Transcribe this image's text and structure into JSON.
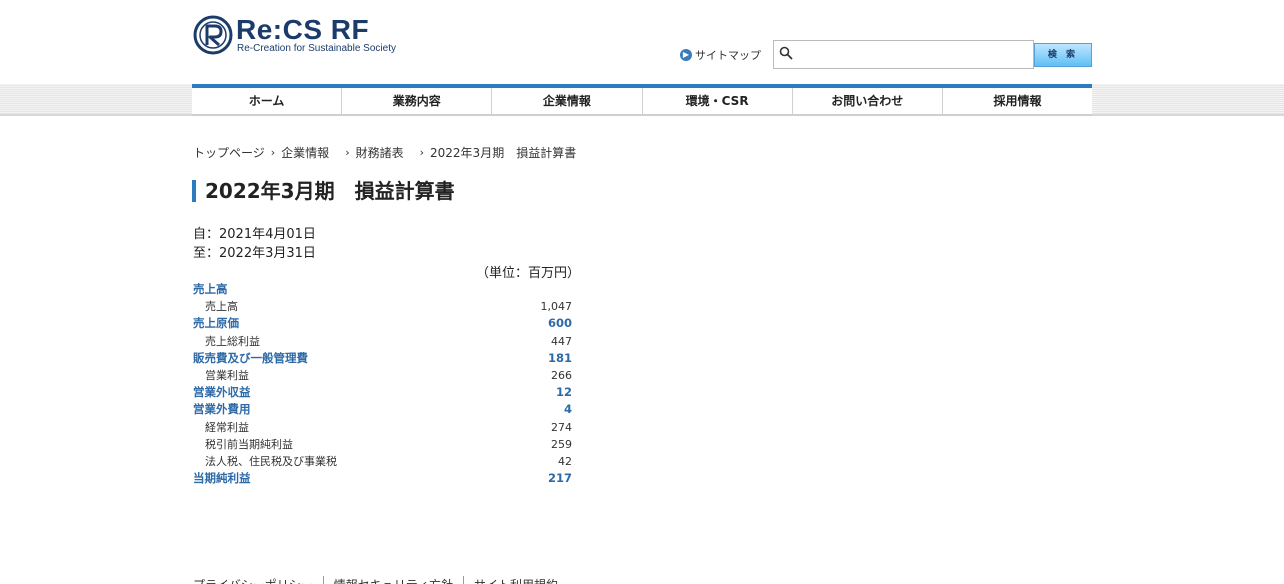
{
  "header": {
    "logo_main": "Re:CS RF",
    "logo_sub": "Re-Creation for Sustainable Society",
    "sitemap_label": "サイトマップ",
    "search_placeholder": "",
    "search_button": "検 索"
  },
  "nav": {
    "items": [
      "ホーム",
      "業務内容",
      "企業情報",
      "環境・CSR",
      "お問い合わせ",
      "採用情報"
    ]
  },
  "breadcrumb": {
    "items": [
      "トップページ",
      "企業情報",
      "財務諸表",
      "2022年3月期　損益計算書"
    ]
  },
  "page": {
    "title": "2022年3月期　損益計算書",
    "period_from": "自：2021年4月01日",
    "period_to": "至：2022年3月31日",
    "unit": "（単位：百万円）"
  },
  "statement": {
    "rows": [
      {
        "label": "売上高",
        "value": "",
        "type": "head"
      },
      {
        "label": "売上高",
        "value": "1,047",
        "type": "sub"
      },
      {
        "label": "売上原価",
        "value": "600",
        "type": "head"
      },
      {
        "label": "売上総利益",
        "value": "447",
        "type": "sub"
      },
      {
        "label": "販売費及び一般管理費",
        "value": "181",
        "type": "head"
      },
      {
        "label": "営業利益",
        "value": "266",
        "type": "sub"
      },
      {
        "label": "営業外収益",
        "value": "12",
        "type": "head"
      },
      {
        "label": "営業外費用",
        "value": "4",
        "type": "head"
      },
      {
        "label": "経常利益",
        "value": "274",
        "type": "sub"
      },
      {
        "label": "税引前当期純利益",
        "value": "259",
        "type": "sub"
      },
      {
        "label": "法人税、住民税及び事業税",
        "value": "42",
        "type": "sub"
      },
      {
        "label": "当期純利益",
        "value": "217",
        "type": "head"
      }
    ]
  },
  "footer": {
    "links": [
      "プライバシーポリシー",
      "情報セキュリティ方針",
      "サイト利用規約"
    ]
  },
  "colors": {
    "accent": "#2d7bbf",
    "heading_text": "#2d6aa8",
    "logo": "#1b3c6b"
  }
}
